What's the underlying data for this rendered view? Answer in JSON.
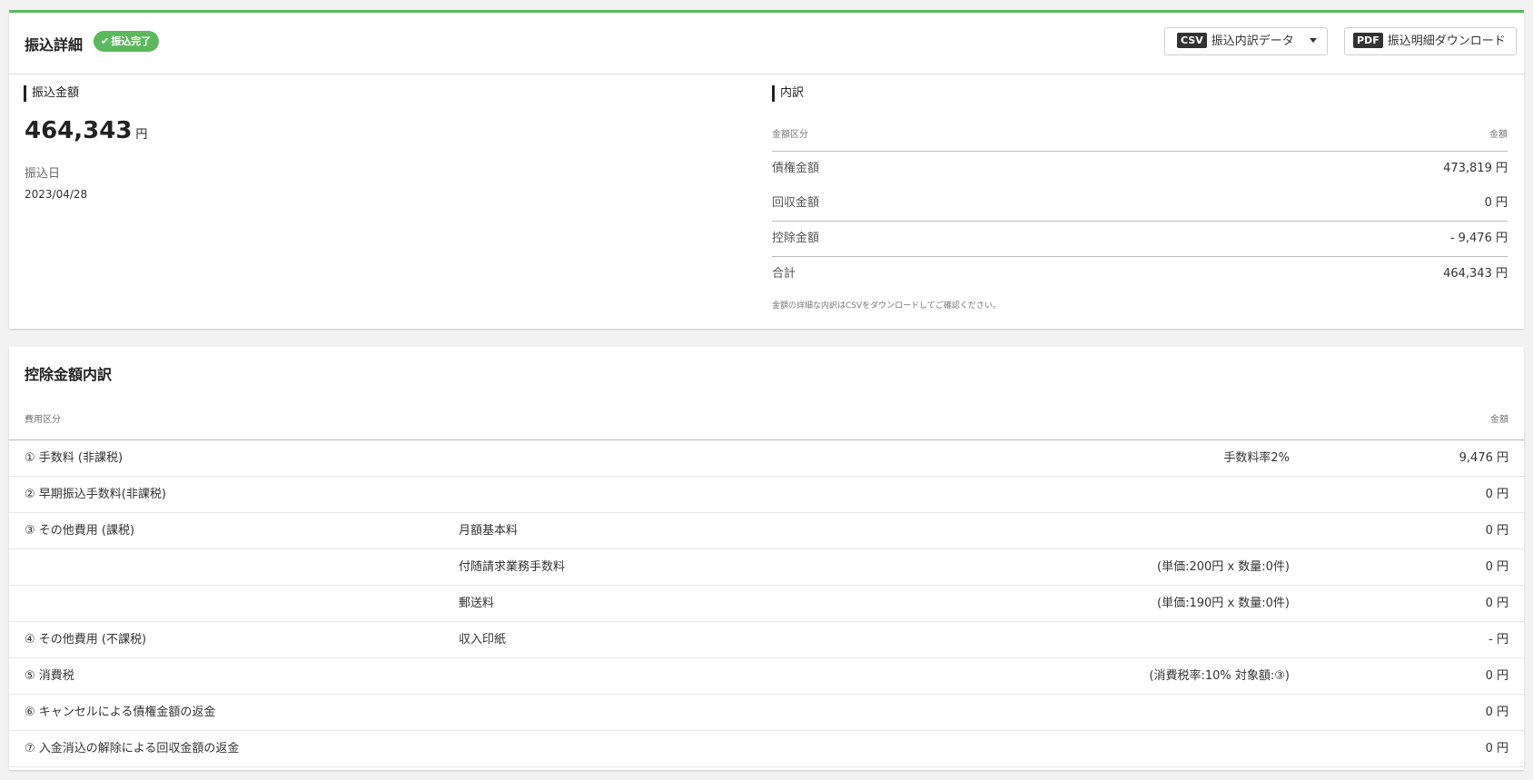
{
  "header": {
    "title": "振込詳細",
    "badge": "振込完了",
    "csv_tag": "CSV",
    "csv_label": "振込内訳データ",
    "pdf_tag": "PDF",
    "pdf_label": "振込明細ダウンロード"
  },
  "transfer": {
    "amount_title": "振込金額",
    "amount": "464,343",
    "unit": "円",
    "date_label": "振込日",
    "date": "2023/04/28"
  },
  "breakdown": {
    "title": "内訳",
    "col_category": "金額区分",
    "col_amount": "金額",
    "rows": [
      {
        "label": "債権金額",
        "value": "473,819 円"
      },
      {
        "label": "回収金額",
        "value": "0 円"
      },
      {
        "label": "控除金額",
        "value": "- 9,476 円"
      },
      {
        "label": "合計",
        "value": "464,343 円"
      }
    ],
    "note": "金額の詳細な内訳はCSVをダウンロードしてご確認ください。"
  },
  "deduction": {
    "title": "控除金額内訳",
    "col_category": "費用区分",
    "col_amount": "金額",
    "rows": [
      {
        "category": "① 手数料 (非課税)",
        "item": "",
        "detail": "手数料率2%",
        "amount": "9,476 円"
      },
      {
        "category": "② 早期振込手数料(非課税)",
        "item": "",
        "detail": "",
        "amount": "0 円"
      },
      {
        "category": "③ その他費用 (課税)",
        "item": "月額基本料",
        "detail": "",
        "amount": "0 円"
      },
      {
        "category": "",
        "item": "付随請求業務手数料",
        "detail": "(単価:200円 x 数量:0件)",
        "amount": "0 円"
      },
      {
        "category": "",
        "item": "郵送料",
        "detail": "(単価:190円 x 数量:0件)",
        "amount": "0 円"
      },
      {
        "category": "④ その他費用 (不課税)",
        "item": "収入印紙",
        "detail": "",
        "amount": "- 円"
      },
      {
        "category": "⑤ 消費税",
        "item": "",
        "detail": "(消費税率:10% 対象額:③)",
        "amount": "0 円"
      },
      {
        "category": "⑥ キャンセルによる債権金額の返金",
        "item": "",
        "detail": "",
        "amount": "0 円"
      },
      {
        "category": "⑦ 入金消込の解除による回収金額の返金",
        "item": "",
        "detail": "",
        "amount": "0 円"
      }
    ]
  },
  "colors": {
    "accent_green": "#5cb85c",
    "dark_tag": "#333333"
  }
}
